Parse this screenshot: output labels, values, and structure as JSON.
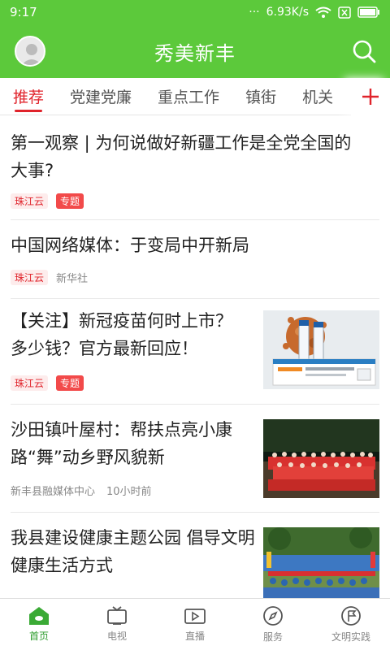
{
  "status": {
    "time": "9:17",
    "dots": "···",
    "speed": "6.93K/s"
  },
  "header": {
    "title": "秀美新丰"
  },
  "tabs": [
    "推荐",
    "党建党廉",
    "重点工作",
    "镇街",
    "机关",
    "…"
  ],
  "articles": [
    {
      "title": "第一观察 | 为何说做好新疆工作是全党全国的大事?",
      "source": "珠江云",
      "tag": "专题"
    },
    {
      "title": "中国网络媒体：于变局中开新局",
      "source": "珠江云",
      "author": "新华社"
    },
    {
      "title": "【关注】新冠疫苗何时上市？多少钱？官方最新回应！",
      "source": "珠江云",
      "tag": "专题"
    },
    {
      "title": "沙田镇叶屋村：帮扶点亮小康路“舞”动乡野风貌新",
      "source": "新丰县融媒体中心",
      "time": "10小时前"
    },
    {
      "title": "我县建设健康主题公园 倡导文明健康生活方式"
    }
  ],
  "nav": [
    {
      "label": "首页",
      "icon": "home-icon"
    },
    {
      "label": "电视",
      "icon": "tv-icon"
    },
    {
      "label": "直播",
      "icon": "live-icon"
    },
    {
      "label": "服务",
      "icon": "compass-icon"
    },
    {
      "label": "文明实践",
      "icon": "flag-icon"
    }
  ],
  "colors": {
    "brand": "#5cc93b",
    "accent": "#e0232b",
    "nav_active": "#2f9d2f"
  }
}
